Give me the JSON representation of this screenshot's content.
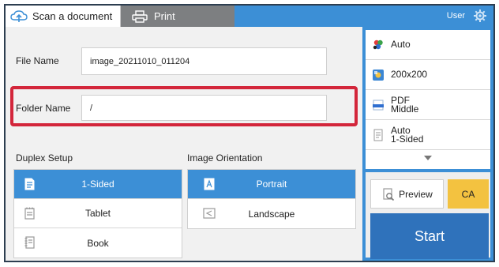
{
  "tabs": [
    {
      "label": "Scan a document",
      "icon": "cloud-scan-icon",
      "active": true
    },
    {
      "label": "Print",
      "icon": "printer-icon",
      "active": false
    }
  ],
  "header": {
    "user_label": "User",
    "settings_icon": "gear-icon"
  },
  "form": {
    "file_name_label": "File Name",
    "file_name_value": "image_20211010_011204",
    "folder_name_label": "Folder Name",
    "folder_name_value": "/",
    "highlight_color": "#d3263b"
  },
  "duplex": {
    "title": "Duplex Setup",
    "options": [
      {
        "label": "1-Sided",
        "icon": "one-sided-page-icon",
        "selected": true
      },
      {
        "label": "Tablet",
        "icon": "tablet-binding-icon",
        "selected": false
      },
      {
        "label": "Book",
        "icon": "book-binding-icon",
        "selected": false
      }
    ]
  },
  "orientation": {
    "title": "Image Orientation",
    "options": [
      {
        "label": "Portrait",
        "icon": "portrait-icon",
        "selected": true
      },
      {
        "label": "Landscape",
        "icon": "landscape-icon",
        "selected": false
      }
    ]
  },
  "settings": [
    {
      "line1": "Auto",
      "line2": "",
      "icon": "color-mode-icon"
    },
    {
      "line1": "200x200",
      "line2": "",
      "icon": "resolution-icon"
    },
    {
      "line1": "PDF",
      "line2": "Middle",
      "icon": "file-format-icon"
    },
    {
      "line1": "Auto",
      "line2": "1-Sided",
      "icon": "original-size-icon"
    }
  ],
  "actions": {
    "preview_label": "Preview",
    "ca_label": "CA",
    "start_label": "Start"
  },
  "colors": {
    "accent": "#3c8fd6",
    "start": "#2f72bb",
    "ca": "#f3c240",
    "print_tab": "#7d7f81"
  }
}
